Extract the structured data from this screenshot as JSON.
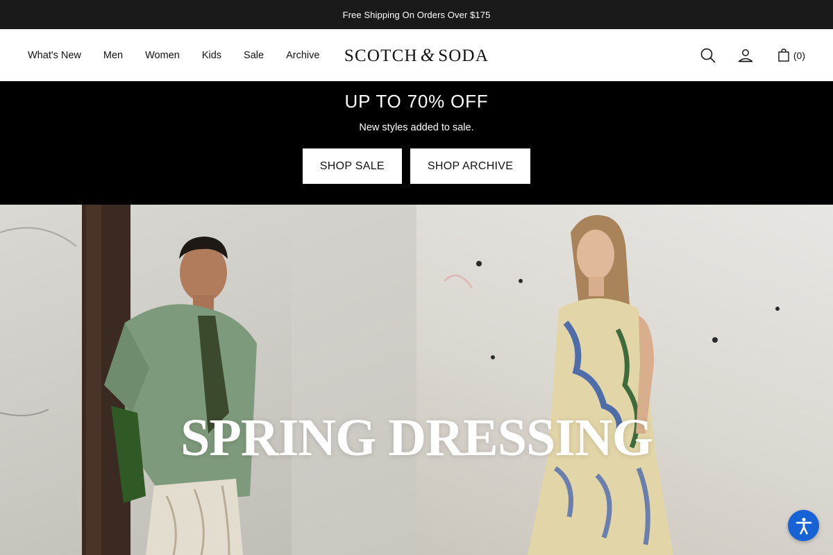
{
  "announcement": {
    "text": "Free Shipping On Orders Over $175"
  },
  "nav": {
    "items": [
      {
        "label": "What's New"
      },
      {
        "label": "Men"
      },
      {
        "label": "Women"
      },
      {
        "label": "Kids"
      },
      {
        "label": "Sale"
      },
      {
        "label": "Archive"
      }
    ]
  },
  "brand": {
    "logo_left": "SCOTCH",
    "logo_amp": "&",
    "logo_right": "SODA"
  },
  "header_icons": {
    "search": "search-icon",
    "account": "user-icon",
    "cart": "shopping-bag-icon",
    "cart_count": "(0)"
  },
  "promo": {
    "title": "UP TO 70% OFF",
    "subtitle": "New styles added to sale.",
    "button_sale": "SHOP SALE",
    "button_archive": "SHOP ARCHIVE"
  },
  "hero": {
    "title": "SPRING DRESSING"
  },
  "accessibility": {
    "icon": "accessibility-icon",
    "color": "#1763d6"
  },
  "colors": {
    "announcement_bg": "#1a1a1a",
    "promo_bg": "#000000",
    "accent": "#1763d6"
  }
}
